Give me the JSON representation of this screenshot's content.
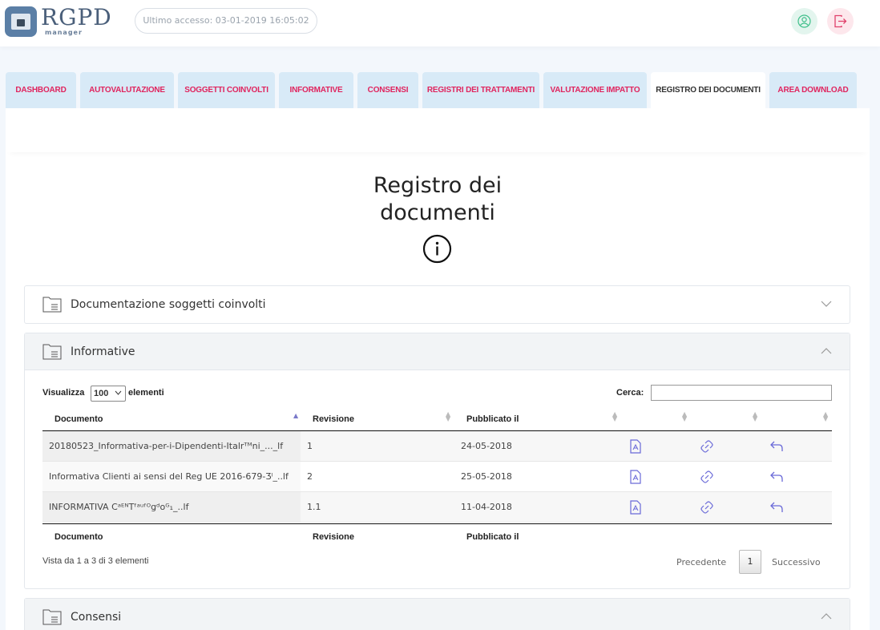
{
  "header": {
    "logo_text": "RGPD",
    "logo_sub": "manager",
    "last_access": "Ultimo accesso: 03-01-2019 16:05:02",
    "user_icon": "user-circle-icon",
    "logout_icon": "logout-icon"
  },
  "colors": {
    "accent_pink": "#e0245e",
    "tab_bg": "#d8eaf7",
    "action_icon": "#6a6ad8"
  },
  "tabs": [
    {
      "label": "DASHBOARD",
      "active": false
    },
    {
      "label": "AUTOVALUTAZIONE",
      "active": false
    },
    {
      "label": "SOGGETTI COINVOLTI",
      "active": false
    },
    {
      "label": "INFORMATIVE",
      "active": false
    },
    {
      "label": "CONSENSI",
      "active": false
    },
    {
      "label": "REGISTRI DEI TRATTAMENTI",
      "active": false
    },
    {
      "label": "VALUTAZIONE IMPATTO",
      "active": false
    },
    {
      "label": "REGISTRO DEI DOCUMENTI",
      "active": true
    },
    {
      "label": "AREA DOWNLOAD",
      "active": false
    }
  ],
  "page": {
    "title_line1": "Registro dei",
    "title_line2": "documenti",
    "info_icon": "info-circle-icon"
  },
  "sections": [
    {
      "title": "Documentazione soggetti coinvolti",
      "expanded": false
    },
    {
      "title": "Informative",
      "expanded": true
    },
    {
      "title": "Consensi",
      "expanded": true
    }
  ],
  "table": {
    "show_label": "Visualizza",
    "show_value": "100",
    "show_suffix": "elementi",
    "search_label": "Cerca:",
    "search_value": "",
    "columns": [
      "Documento",
      "Revisione",
      "Pubblicato il"
    ],
    "rows": [
      {
        "documento": "20180523_Informativa-per-i-Dipendenti-Italrᵀᴹni_..._lf",
        "revisione": "1",
        "pubblicato": "24-05-2018"
      },
      {
        "documento": "Informativa Clienti ai sensi del Reg UE 2016-679-Ʒˡ_..lf",
        "revisione": "2",
        "pubblicato": "25-05-2018"
      },
      {
        "documento": "INFORMATIVA CᵃᴱᴺTᶠᵃᵘᶠᴼgᵈᴏᴳ₁_..lf",
        "revisione": "1.1",
        "pubblicato": "11-04-2018"
      }
    ],
    "row_actions": [
      "pdf-file-icon",
      "link-icon",
      "undo-arrow-icon"
    ],
    "info": "Vista da 1 a 3 di 3 elementi",
    "pagination": {
      "prev": "Precedente",
      "current": "1",
      "next": "Successivo"
    }
  }
}
